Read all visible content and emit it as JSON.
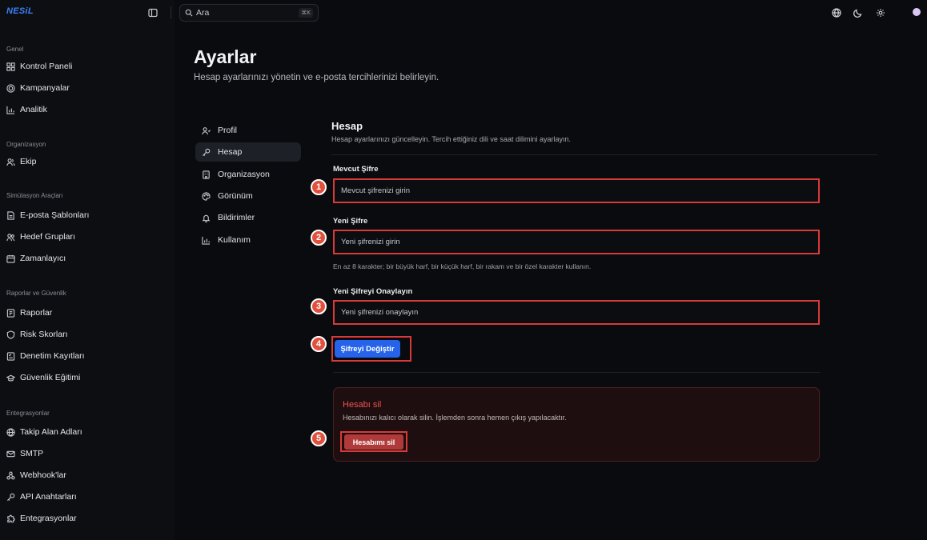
{
  "app": {
    "brand": "NESiL"
  },
  "topbar": {
    "search_placeholder": "Ara",
    "search_shortcut": "⌘K",
    "icons": [
      "globe-icon",
      "moon-icon",
      "settings-icon",
      "avatar"
    ]
  },
  "sidebar": {
    "sections": [
      {
        "title": "Genel",
        "items": [
          {
            "label": "Kontrol Paneli",
            "icon": "dashboard-icon"
          },
          {
            "label": "Kampanyalar",
            "icon": "target-icon"
          },
          {
            "label": "Analitik",
            "icon": "chart-icon"
          }
        ]
      },
      {
        "title": "Organizasyon",
        "items": [
          {
            "label": "Ekip",
            "icon": "users-icon"
          }
        ]
      },
      {
        "title": "Simülasyon Araçları",
        "items": [
          {
            "label": "E-posta Şablonları",
            "icon": "document-icon"
          },
          {
            "label": "Hedef Grupları",
            "icon": "group-icon"
          },
          {
            "label": "Zamanlayıcı",
            "icon": "calendar-icon"
          }
        ]
      },
      {
        "title": "Raporlar ve Güvenlik",
        "items": [
          {
            "label": "Raporlar",
            "icon": "report-icon"
          },
          {
            "label": "Risk Skorları",
            "icon": "shield-icon"
          },
          {
            "label": "Denetim Kayıtları",
            "icon": "audit-icon"
          },
          {
            "label": "Güvenlik Eğitimi",
            "icon": "graduation-icon"
          }
        ]
      },
      {
        "title": "Entegrasyonlar",
        "items": [
          {
            "label": "Takip Alan Adları",
            "icon": "globe-icon"
          },
          {
            "label": "SMTP",
            "icon": "mail-icon"
          },
          {
            "label": "Webhook'lar",
            "icon": "webhook-icon"
          },
          {
            "label": "API Anahtarları",
            "icon": "key-icon"
          },
          {
            "label": "Entegrasyonlar",
            "icon": "puzzle-icon"
          }
        ]
      }
    ]
  },
  "page": {
    "title": "Ayarlar",
    "subtitle": "Hesap ayarlarınızı yönetin ve e-posta tercihlerinizi belirleyin."
  },
  "settings_nav": [
    {
      "label": "Profil",
      "icon": "user-icon",
      "active": false
    },
    {
      "label": "Hesap",
      "icon": "key-icon",
      "active": true
    },
    {
      "label": "Organizasyon",
      "icon": "building-icon",
      "active": false
    },
    {
      "label": "Görünüm",
      "icon": "palette-icon",
      "active": false
    },
    {
      "label": "Bildirimler",
      "icon": "bell-icon",
      "active": false
    },
    {
      "label": "Kullanım",
      "icon": "chart-icon",
      "active": false
    }
  ],
  "account": {
    "title": "Hesap",
    "description": "Hesap ayarlarınızı güncelleyin. Tercih ettiğiniz dili ve saat dilimini ayarlayın.",
    "current_password": {
      "label": "Mevcut Şifre",
      "placeholder": "Mevcut şifrenizi girin",
      "value": ""
    },
    "new_password": {
      "label": "Yeni Şifre",
      "placeholder": "Yeni şifrenizi girin",
      "value": ""
    },
    "password_help": "En az 8 karakter; bir büyük harf, bir küçük harf, bir rakam ve bir özel karakter kullanın.",
    "confirm_password": {
      "label": "Yeni Şifreyi Onaylayın",
      "placeholder": "Yeni şifrenizi onaylayın",
      "value": ""
    },
    "change_button": "Şifreyi Değiştir"
  },
  "danger_zone": {
    "title": "Hesabı sil",
    "description": "Hesabınızı kalıcı olarak silin. İşlemden sonra hemen çıkış yapılacaktır.",
    "delete_button": "Hesabımı sil"
  },
  "markers": [
    "1",
    "2",
    "3",
    "4",
    "5"
  ],
  "colors": {
    "accent": "#2563eb",
    "danger": "#ef5350",
    "highlight": "#d83a3a",
    "brand": "#3b82f6"
  }
}
